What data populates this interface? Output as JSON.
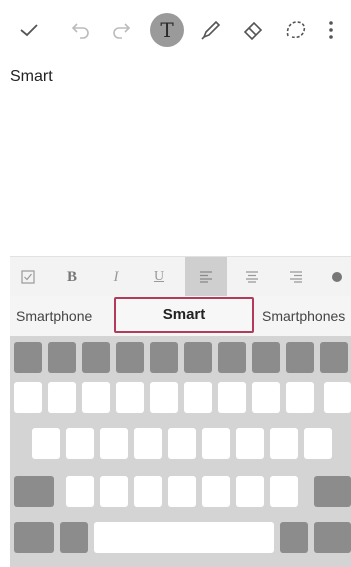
{
  "toolbar": {
    "icons": [
      "check-icon",
      "undo-icon",
      "redo-icon",
      "text-tool-icon",
      "pen-icon",
      "eraser-icon",
      "lasso-icon",
      "more-vert-icon"
    ],
    "text_tool_label": "T"
  },
  "note": {
    "text": "Smart"
  },
  "format_bar": {
    "bold_label": "B",
    "italic_label": "I",
    "underline_label": "U"
  },
  "suggestions": {
    "left": "Smartphone",
    "middle": "Smart",
    "right": "Smartphones"
  },
  "colors": {
    "accent": "#b23a5a",
    "selected_tool": "#9a9a9a",
    "key_dark": "#8c8c8c",
    "keyboard_bg": "#d4d4d4"
  }
}
